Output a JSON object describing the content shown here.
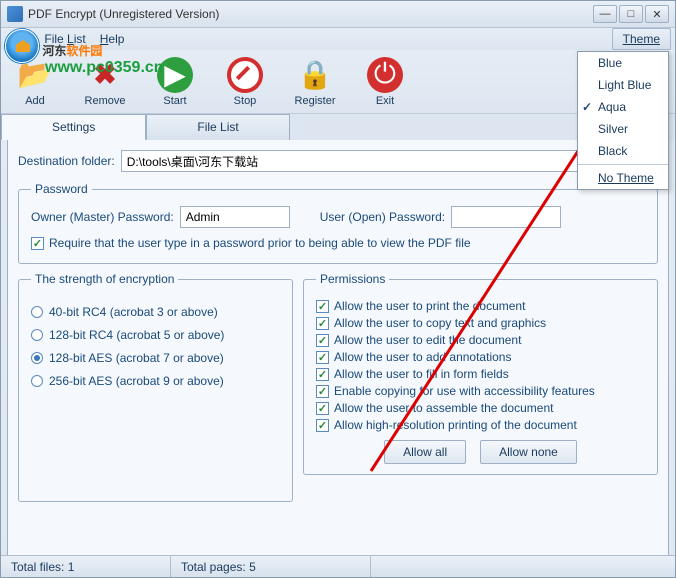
{
  "window": {
    "title": "PDF Encrypt (Unregistered Version)"
  },
  "watermark": {
    "cn1": "河东",
    "cn2": "软件园",
    "url": "www.pc0359.cn"
  },
  "menubar": {
    "file": "File",
    "filelist": "File List",
    "help": "Help",
    "theme": "Theme"
  },
  "toolbar": {
    "add": "Add",
    "remove": "Remove",
    "start": "Start",
    "stop": "Stop",
    "register": "Register",
    "exit": "Exit"
  },
  "tabs": {
    "settings": "Settings",
    "filelist": "File List"
  },
  "dest": {
    "label": "Destination folder:",
    "value": "D:\\tools\\桌面\\河东下载站"
  },
  "password": {
    "legend": "Password",
    "owner_label": "Owner (Master) Password:",
    "owner_value": "Admin",
    "user_label": "User (Open) Password:",
    "user_value": "",
    "require": "Require that the user type in a password prior to being able to view the PDF file"
  },
  "encryption": {
    "legend": "The strength of encryption",
    "options": [
      {
        "label": "40-bit RC4 (acrobat 3 or above)",
        "selected": false
      },
      {
        "label": "128-bit RC4 (acrobat 5 or above)",
        "selected": false
      },
      {
        "label": "128-bit AES (acrobat 7 or above)",
        "selected": true
      },
      {
        "label": "256-bit AES (acrobat 9 or above)",
        "selected": false
      }
    ]
  },
  "permissions": {
    "legend": "Permissions",
    "items": [
      "Allow the user to print the document",
      "Allow the user to copy text and graphics",
      "Allow the user to edit the document",
      "Allow the user to add annotations",
      "Allow the user to fill in form fields",
      "Enable copying for use with accessibility features",
      "Allow the user to assemble the document",
      "Allow high-resolution printing of the document"
    ],
    "allow_all": "Allow all",
    "allow_none": "Allow none"
  },
  "theme_menu": {
    "items": [
      {
        "label": "Blue",
        "checked": false,
        "underlined": false
      },
      {
        "label": "Light Blue",
        "checked": false,
        "underlined": false
      },
      {
        "label": "Aqua",
        "checked": true,
        "underlined": false
      },
      {
        "label": "Silver",
        "checked": false,
        "underlined": false
      },
      {
        "label": "Black",
        "checked": false,
        "underlined": false
      }
    ],
    "no_theme": "No Theme"
  },
  "status": {
    "total_files_label": "Total files:",
    "total_files": "1",
    "total_pages_label": "Total pages:",
    "total_pages": "5"
  }
}
